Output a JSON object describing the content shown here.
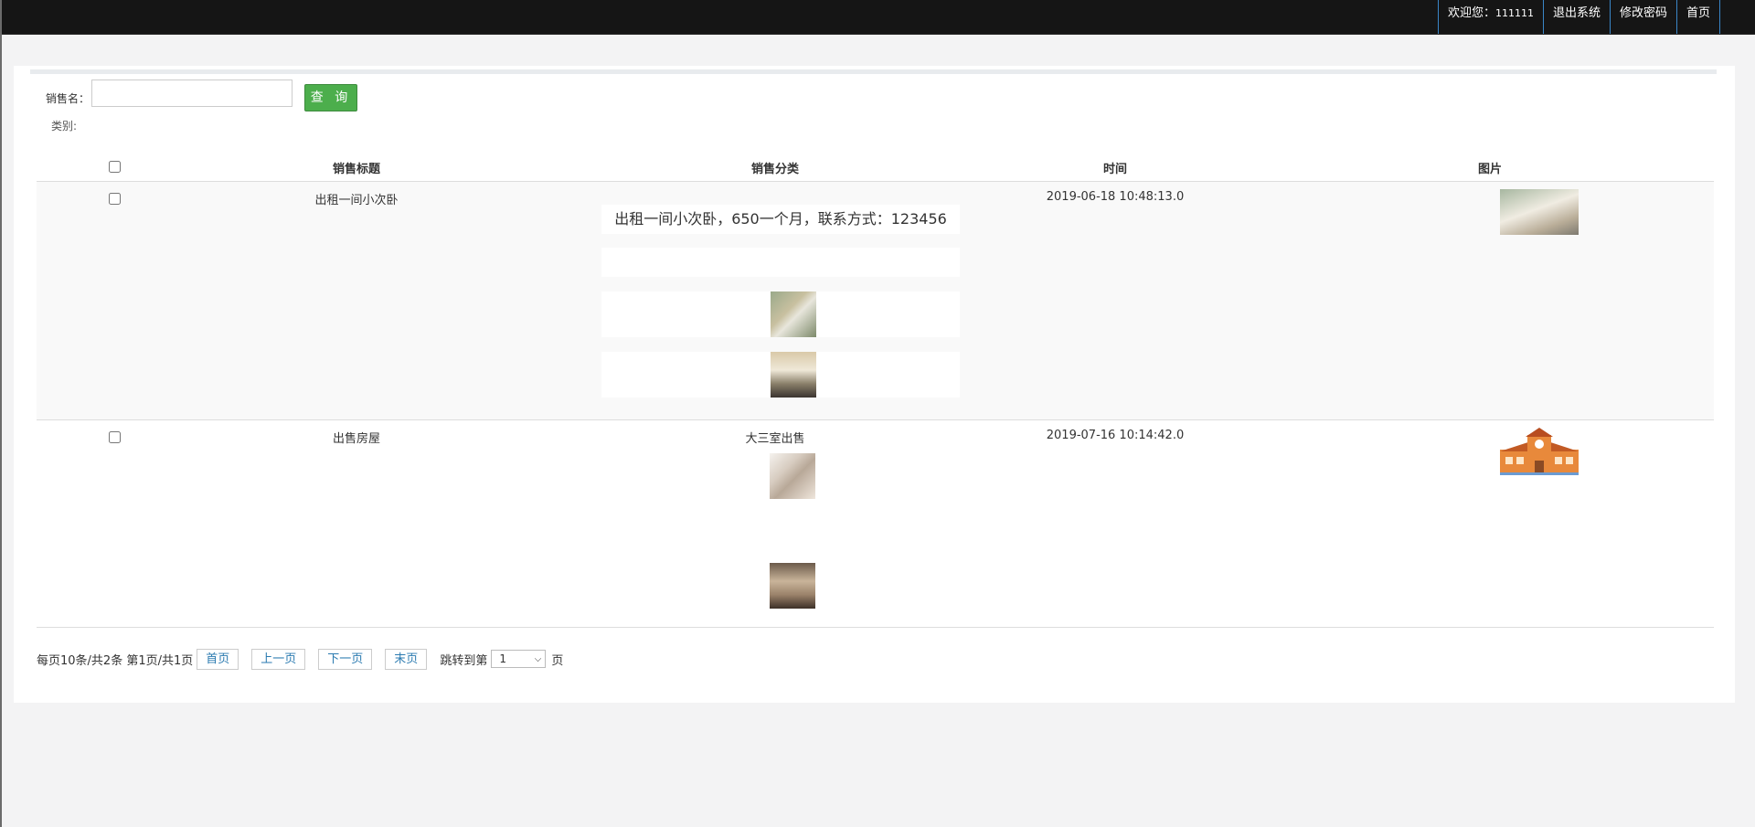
{
  "topnav": {
    "welcome_label": "欢迎您：",
    "user_name": "111111",
    "logout": "退出系统",
    "change_password": "修改密码",
    "home": "首页"
  },
  "search": {
    "label": "销售名：",
    "value": "",
    "button": "查 询",
    "category_label": "类别:"
  },
  "table": {
    "headers": [
      "",
      "销售标题",
      "销售分类",
      "时间",
      "图片"
    ],
    "rows": [
      {
        "title": "出租一间小次卧",
        "category_text": "出租一间小次卧，650一个月，联系方式：123456",
        "time": "2019-06-18 10:48:13.0"
      },
      {
        "title": "出售房屋",
        "category_text": "大三室出售",
        "time": "2019-07-16 10:14:42.0"
      }
    ]
  },
  "pager": {
    "info": "每页10条/共2条 第1页/共1页",
    "first": "首页",
    "prev": "上一页",
    "next": "下一页",
    "last": "末页",
    "jump_label": "跳转到第",
    "jump_value": "1",
    "jump_unit": "页"
  }
}
